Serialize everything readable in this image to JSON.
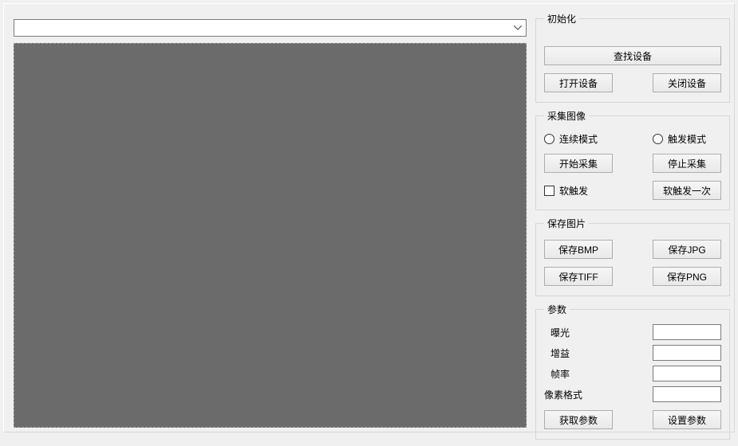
{
  "init": {
    "legend": "初始化",
    "find_device": "查找设备",
    "open_device": "打开设备",
    "close_device": "关闭设备"
  },
  "capture": {
    "legend": "采集图像",
    "continuous_mode": "连续模式",
    "trigger_mode": "触发模式",
    "start_capture": "开始采集",
    "stop_capture": "停止采集",
    "soft_trigger": "软触发",
    "soft_trigger_once": "软触发一次"
  },
  "save": {
    "legend": "保存图片",
    "save_bmp": "保存BMP",
    "save_jpg": "保存JPG",
    "save_tiff": "保存TIFF",
    "save_png": "保存PNG"
  },
  "params": {
    "legend": "参数",
    "exposure": "曝光",
    "gain": "增益",
    "framerate": "帧率",
    "pixel_format": "像素格式",
    "get_params": "获取参数",
    "set_params": "设置参数",
    "exposure_value": "",
    "gain_value": "",
    "framerate_value": "",
    "pixel_format_value": ""
  },
  "dropdown": {
    "value": ""
  }
}
